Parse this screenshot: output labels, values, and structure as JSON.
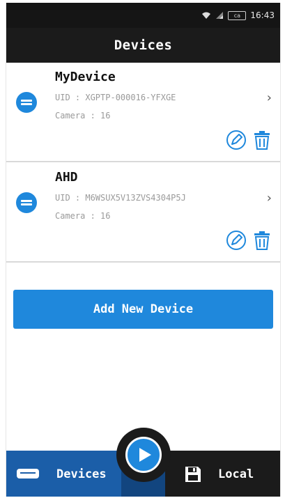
{
  "status_bar": {
    "time": "16:43",
    "battery": "ca"
  },
  "header": {
    "title": "Devices"
  },
  "devices": [
    {
      "name": "MyDevice",
      "uid": "UID : XGPTP-000016-YFXGE",
      "camera": "Camera : 16"
    },
    {
      "name": "AHD",
      "uid": "UID : M6WSUX5V13ZVS4304P5J",
      "camera": "Camera : 16"
    }
  ],
  "add_device_label": "Add New Device",
  "tabs": [
    {
      "label": "Devices",
      "icon": "dvr-icon",
      "active": true
    },
    {
      "label": "Local",
      "icon": "save-icon",
      "active": false
    }
  ],
  "center_button": {
    "icon": "play-icon"
  },
  "colors": {
    "accent": "#1f88dc",
    "dark": "#1b1b1b",
    "tab_active": "#1b5ea8"
  }
}
